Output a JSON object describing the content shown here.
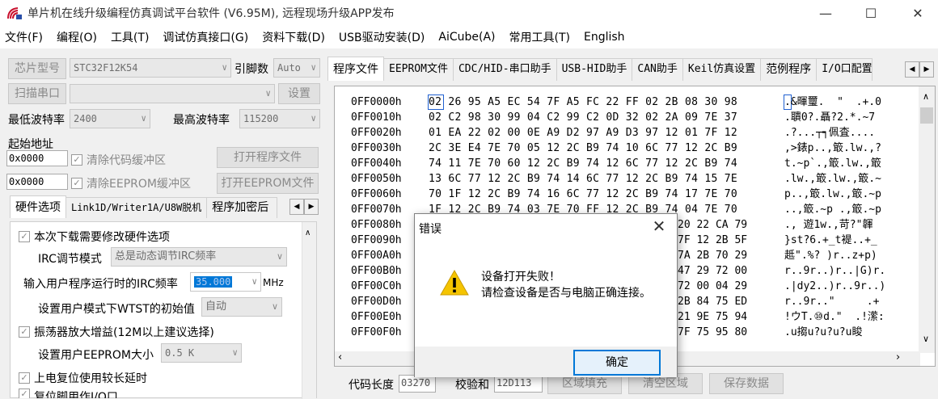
{
  "window": {
    "title": "单片机在线升级编程仿真调试平台软件 (V6.95M), 远程现场升级APP发布",
    "minimize": "—",
    "maximize": "☐",
    "close": "✕"
  },
  "menu": [
    "文件(F)",
    "编程(O)",
    "工具(T)",
    "调试仿真接口(G)",
    "资料下载(D)",
    "USB驱动安装(D)",
    "AiCube(A)",
    "常用工具(T)",
    "English"
  ],
  "left": {
    "chip_model_label": "芯片型号",
    "chip_model_value": "STC32F12K54",
    "pin_label": "引脚数",
    "pin_value": "Auto",
    "scan_port_button": "扫描串口",
    "settings_button": "设置",
    "min_baud_label": "最低波特率",
    "min_baud_value": "2400",
    "max_baud_label": "最高波特率",
    "max_baud_value": "115200",
    "start_addr_label": "起始地址",
    "code_addr": "0x0000",
    "clear_code_label": "清除代码缓冲区",
    "open_program_button": "打开程序文件",
    "eeprom_addr": "0x0000",
    "clear_eeprom_label": "清除EEPROM缓冲区",
    "open_eeprom_button": "打开EEPROM文件",
    "tabs": [
      "硬件选项",
      "Link1D/Writer1A/U8W脱机",
      "程序加密后"
    ],
    "hw": {
      "modify_hw": "本次下载需要修改硬件选项",
      "irc_mode_label": "IRC调节模式",
      "irc_mode_value": "总是动态调节IRC频率",
      "irc_freq_label": "输入用户程序运行时的IRC频率",
      "irc_freq_value": "35.000",
      "irc_freq_unit": "MHz",
      "wdt_label": "设置用户模式下WTST的初始值",
      "wdt_value": "自动",
      "osc_gain": "振荡器放大增益(12M以上建议选择)",
      "eeprom_size_label": "设置用户EEPROM大小",
      "eeprom_size_value": "0.5 K",
      "power_reset": "上电复位使用较长延时",
      "reset_pin": "复位脚用作I/O口"
    }
  },
  "right": {
    "tabs": [
      "程序文件",
      "EEPROM文件",
      "CDC/HID-串口助手",
      "USB-HID助手",
      "CAN助手",
      "Keil仿真设置",
      "范例程序",
      "I/O口配置"
    ],
    "hex": [
      {
        "addr": "0FF0000h",
        "bytes": "02 26 95 A5 EC 54 7F A5 FC 22 FF 02 2B 08 30 98",
        "ascii": ".&暉璽.  \"  .+.0"
      },
      {
        "addr": "0FF0010h",
        "bytes": "02 C2 98 30 99 04 C2 99 C2 0D 32 02 2A 09 7E 37",
        "ascii": ".聵0?.聶?2.*.~7"
      },
      {
        "addr": "0FF0020h",
        "bytes": "01 EA 22 02 00 0E A9 D2 97 A9 D3 97 12 01 7F 12",
        "ascii": ".?...┬┑佩査...."
      },
      {
        "addr": "0FF0030h",
        "bytes": "2C 3E E4 7E 70 05 12 2C B9 74 10 6C 77 12 2C B9",
        "ascii": ",>錶p..,箃.lw.,?"
      },
      {
        "addr": "0FF0040h",
        "bytes": "74 11 7E 70 60 12 2C B9 74 12 6C 77 12 2C B9 74",
        "ascii": "t.~p`.,箃.lw.,箃"
      },
      {
        "addr": "0FF0050h",
        "bytes": "13 6C 77 12 2C B9 74 14 6C 77 12 2C B9 74 15 7E",
        "ascii": ".lw.,箃.lw.,箃.~"
      },
      {
        "addr": "0FF0060h",
        "bytes": "70 1F 12 2C B9 74 16 6C 77 12 2C B9 74 17 7E 70",
        "ascii": "p..,箃.lw.,箃.~p"
      },
      {
        "addr": "0FF0070h",
        "bytes": "1F 12 2C B9 74 03 7E 70 FF 12 2C B9 74 04 7E 70",
        "ascii": "..,箃.~p .,箃.~p"
      },
      {
        "addr": "0FF0080h",
        "bytes": "",
        "ascii": "., 遊1w.,苛?\"韗"
      },
      {
        "addr": "0FF0090h",
        "bytes": "",
        "ascii": "}st?6.+_t褆..+_"
      },
      {
        "addr": "0FF00A0h",
        "bytes": "",
        "ascii": "趆\".%? )r..z+p)"
      },
      {
        "addr": "0FF00B0h",
        "bytes": "",
        "ascii": "r..9r..)r..|G)r."
      },
      {
        "addr": "0FF00C0h",
        "bytes": "",
        "ascii": ".|dy2..)r..9r..)"
      },
      {
        "addr": "0FF00D0h",
        "bytes": "",
        "ascii": "r..9r..\"     .+"
      },
      {
        "addr": "0FF00E0h",
        "bytes": "",
        "ascii": "!ウT.⑩d.\"  .!潆:"
      },
      {
        "addr": "0FF00F0h",
        "bytes": "",
        "ascii": ".u搊u?u?u?u睃"
      }
    ],
    "hex_partial_right": [
      {
        "row": 8,
        "bytes": "20 22 CA 79"
      },
      {
        "row": 9,
        "bytes": "7F 12 2B 5F"
      },
      {
        "row": 10,
        "bytes": "7A 2B 70 29"
      },
      {
        "row": 11,
        "bytes": "47 29 72 00"
      },
      {
        "row": 12,
        "bytes": "72 00 04 29"
      },
      {
        "row": 13,
        "bytes": "2B 84 75 ED"
      },
      {
        "row": 14,
        "bytes": "21 9E 75 94"
      },
      {
        "row": 15,
        "bytes": "7F 75 95 80"
      }
    ],
    "code_len_label": "代码长度",
    "code_len_value": "03270",
    "checksum_label": "校验和",
    "checksum_value": "12D113",
    "fill_button": "区域填充",
    "clear_button": "清空区域",
    "save_button": "保存数据"
  },
  "dialog": {
    "title": "错误",
    "close": "✕",
    "line1": "设备打开失败！",
    "line2": "请检查设备是否与电脑正确连接。",
    "ok_label": "确定"
  },
  "colors": {
    "accent": "#0078d7",
    "warning": "#f5c400"
  }
}
